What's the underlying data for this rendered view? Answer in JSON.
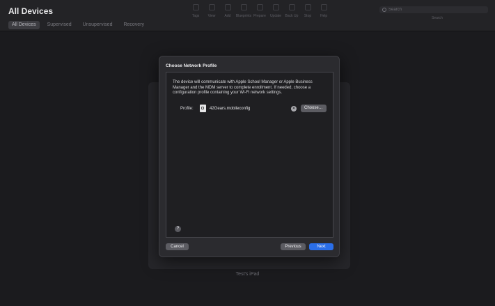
{
  "window": {
    "title": "All Devices"
  },
  "filters": [
    {
      "label": "All Devices",
      "active": true
    },
    {
      "label": "Supervised",
      "active": false
    },
    {
      "label": "Unsupervised",
      "active": false
    },
    {
      "label": "Recovery",
      "active": false
    }
  ],
  "toolbar": [
    {
      "label": "Tags",
      "icon": "tag-icon"
    },
    {
      "label": "View",
      "icon": "view-icon"
    },
    {
      "label": "Add",
      "icon": "add-icon"
    },
    {
      "label": "Blueprints",
      "icon": "blueprint-icon"
    },
    {
      "label": "Prepare",
      "icon": "prepare-icon"
    },
    {
      "label": "Update",
      "icon": "update-icon"
    },
    {
      "label": "Back Up",
      "icon": "backup-icon"
    },
    {
      "label": "Stop",
      "icon": "stop-icon"
    },
    {
      "label": "Help",
      "icon": "help-icon"
    }
  ],
  "search": {
    "placeholder": "Search",
    "caption": "Search"
  },
  "device": {
    "name": "Test's iPad"
  },
  "sheet": {
    "title": "Choose Network Profile",
    "description": "The device will communicate with Apple School Manager or Apple Business Manager and the MDM server to complete enrollment. If needed, choose a configuration profile containing your Wi-Fi network settings.",
    "profile_label": "Profile:",
    "profile_name": "42Gears.mobileconfig",
    "clear_glyph": "×",
    "choose_label": "Choose…",
    "help_glyph": "?",
    "cancel_label": "Cancel",
    "previous_label": "Previous",
    "next_label": "Next"
  },
  "colors": {
    "accent": "#2a6ee8",
    "background": "#1b1b1e",
    "sheet": "#2b2b2f"
  }
}
